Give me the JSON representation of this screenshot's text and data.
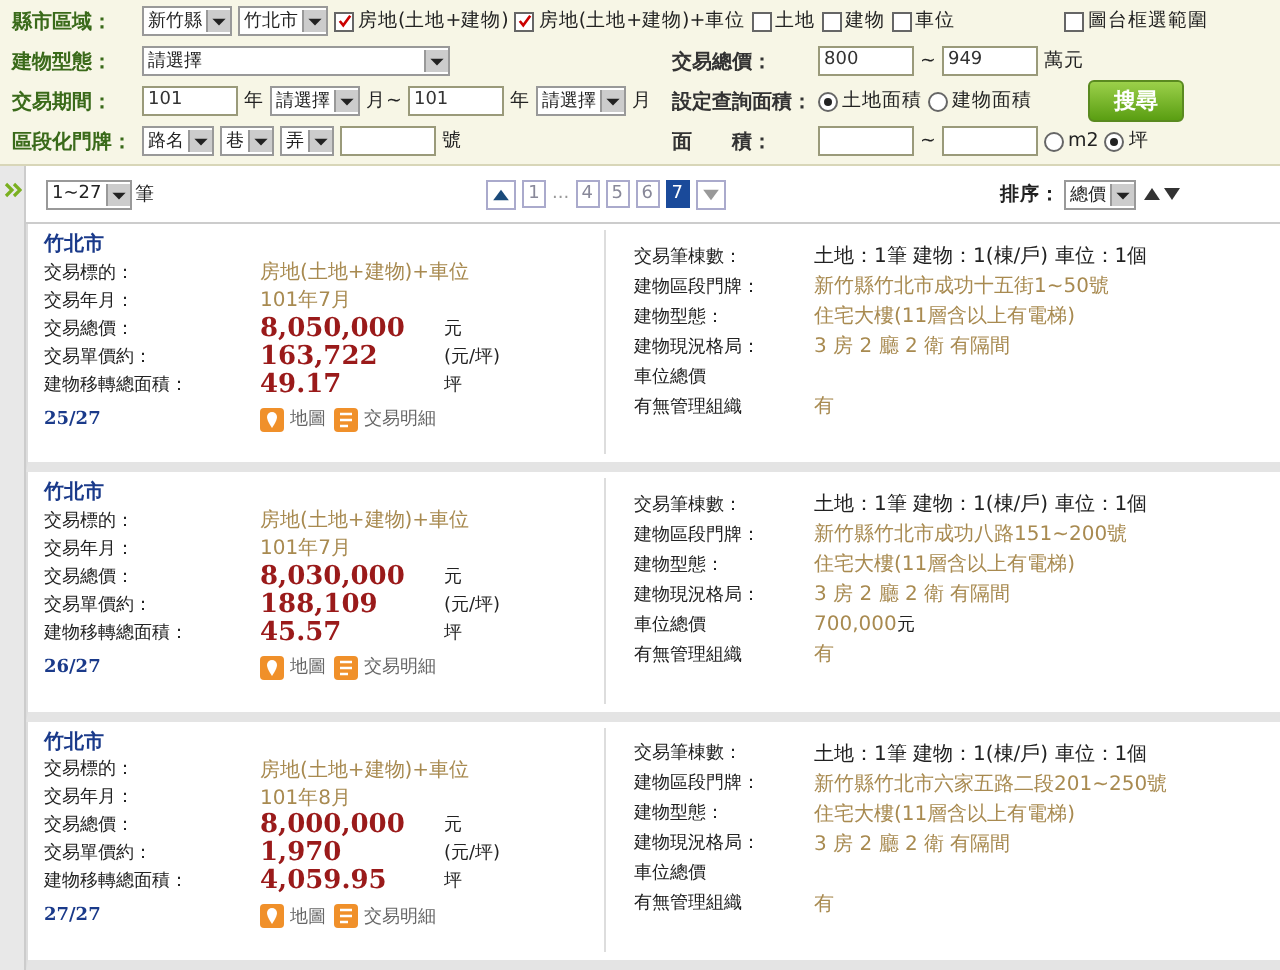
{
  "form": {
    "rows": [
      {
        "left": {
          "label": "縣市區域：",
          "parts": [
            {
              "kind": "select",
              "value": "新竹縣"
            },
            {
              "kind": "select",
              "value": "竹北市"
            },
            {
              "kind": "checkbox",
              "label": "房地(土地+建物)",
              "checked": true
            },
            {
              "kind": "checkbox",
              "label": "房地(土地+建物)+車位",
              "checked": true
            },
            {
              "kind": "checkbox",
              "label": "土地",
              "checked": false
            },
            {
              "kind": "checkbox",
              "label": "建物",
              "checked": false
            },
            {
              "kind": "checkbox",
              "label": "車位",
              "checked": false
            }
          ]
        },
        "right": {
          "parts": [
            {
              "kind": "checkbox",
              "label": "圖台框選範圍",
              "checked": false
            }
          ]
        }
      },
      {
        "left": {
          "label": "建物型態：",
          "parts": [
            {
              "kind": "long_select",
              "value": "請選擇"
            }
          ]
        },
        "right": {
          "label": "交易總價：",
          "parts": [
            {
              "kind": "input",
              "value": "800"
            },
            {
              "kind": "text",
              "text": "~"
            },
            {
              "kind": "input",
              "value": "949"
            },
            {
              "kind": "text",
              "text": "萬元"
            }
          ]
        }
      },
      {
        "left": {
          "label": "交易期間：",
          "parts": [
            {
              "kind": "input",
              "value": "101"
            },
            {
              "kind": "text",
              "text": "年"
            },
            {
              "kind": "select",
              "value": "請選擇"
            },
            {
              "kind": "text",
              "text": "月~"
            },
            {
              "kind": "input",
              "value": "101"
            },
            {
              "kind": "text",
              "text": "年"
            },
            {
              "kind": "select",
              "value": "請選擇"
            },
            {
              "kind": "text",
              "text": "月"
            }
          ]
        },
        "right": {
          "label": "設定查詢面積：",
          "parts": [
            {
              "kind": "radio",
              "label": "土地面積",
              "selected": true
            },
            {
              "kind": "radio",
              "label": "建物面積",
              "selected": false
            }
          ]
        }
      },
      {
        "left": {
          "label": "區段化門牌：",
          "parts": [
            {
              "kind": "select",
              "value": "路名"
            },
            {
              "kind": "select",
              "value": "巷"
            },
            {
              "kind": "select",
              "value": "弄"
            },
            {
              "kind": "input"
            },
            {
              "kind": "text",
              "text": "號"
            }
          ]
        },
        "right": {
          "label": "面　　積：",
          "parts": [
            {
              "kind": "input"
            },
            {
              "kind": "text",
              "text": "~"
            },
            {
              "kind": "input"
            },
            {
              "kind": "radio",
              "label": "m2",
              "selected": false
            },
            {
              "kind": "radio",
              "label": "坪",
              "selected": true
            }
          ]
        }
      }
    ],
    "search_button": "搜尋"
  },
  "pagination": {
    "per_page": "1~27",
    "per_page_unit": "筆",
    "pages": [
      {
        "kind": "prev"
      },
      {
        "kind": "page",
        "label": "1",
        "selected": false
      },
      {
        "kind": "ellipsis",
        "label": "..."
      },
      {
        "kind": "page",
        "label": "4",
        "selected": false
      },
      {
        "kind": "page",
        "label": "5",
        "selected": false
      },
      {
        "kind": "page",
        "label": "6",
        "selected": false
      },
      {
        "kind": "page",
        "label": "7",
        "selected": true
      },
      {
        "kind": "next"
      }
    ],
    "sort_label": "排序：",
    "sort_value": "總價"
  },
  "records": [
    {
      "city": "竹北市",
      "index": "25/27",
      "left": [
        {
          "label": "交易標的：",
          "kind": "text",
          "value": "房地(土地+建物)+車位"
        },
        {
          "label": "交易年月：",
          "kind": "text",
          "value": "101年7月"
        },
        {
          "label": "交易總價：",
          "kind": "price",
          "value": "8,050,000",
          "unit": "元"
        },
        {
          "label": "交易單價約：",
          "kind": "price",
          "value": "163,722",
          "unit": "(元/坪)"
        },
        {
          "label": "建物移轉總面積：",
          "kind": "price",
          "value": "49.17",
          "unit": "坪"
        }
      ],
      "links": [
        {
          "kind": "map",
          "label": "地圖"
        },
        {
          "kind": "detail",
          "label": "交易明細"
        }
      ],
      "right": [
        {
          "label": "交易筆棟數：",
          "kind": "plain",
          "value": "土地：1筆 建物：1(棟/戶) 車位：1個"
        },
        {
          "label": "建物區段門牌：",
          "kind": "text",
          "value": "新竹縣竹北市成功十五街1~50號"
        },
        {
          "label": "建物型態：",
          "kind": "text",
          "value": "住宅大樓(11層含以上有電梯)"
        },
        {
          "label": "建物現況格局：",
          "kind": "text",
          "value": "3 房 2 廳 2 衛 有隔間"
        },
        {
          "label": "車位總價"
        },
        {
          "label": "有無管理組織",
          "kind": "text",
          "value": "有"
        }
      ]
    },
    {
      "city": "竹北市",
      "index": "26/27",
      "left": [
        {
          "label": "交易標的：",
          "kind": "text",
          "value": "房地(土地+建物)+車位"
        },
        {
          "label": "交易年月：",
          "kind": "text",
          "value": "101年7月"
        },
        {
          "label": "交易總價：",
          "kind": "price",
          "value": "8,030,000",
          "unit": "元"
        },
        {
          "label": "交易單價約：",
          "kind": "price",
          "value": "188,109",
          "unit": "(元/坪)"
        },
        {
          "label": "建物移轉總面積：",
          "kind": "price",
          "value": "45.57",
          "unit": "坪"
        }
      ],
      "links": [
        {
          "kind": "map",
          "label": "地圖"
        },
        {
          "kind": "detail",
          "label": "交易明細"
        }
      ],
      "right": [
        {
          "label": "交易筆棟數：",
          "kind": "plain",
          "value": "土地：1筆 建物：1(棟/戶) 車位：1個"
        },
        {
          "label": "建物區段門牌：",
          "kind": "text",
          "value": "新竹縣竹北市成功八路151~200號"
        },
        {
          "label": "建物型態：",
          "kind": "text",
          "value": "住宅大樓(11層含以上有電梯)"
        },
        {
          "label": "建物現況格局：",
          "kind": "text",
          "value": "3 房 2 廳 2 衛 有隔間"
        },
        {
          "label": "車位總價",
          "kind": "text",
          "value": "700,000",
          "unit": "元"
        },
        {
          "label": "有無管理組織",
          "kind": "text",
          "value": "有"
        }
      ]
    },
    {
      "city": "竹北市",
      "index": "27/27",
      "left": [
        {
          "label": "交易標的：",
          "kind": "text",
          "value": "房地(土地+建物)+車位"
        },
        {
          "label": "交易年月：",
          "kind": "text",
          "value": "101年8月"
        },
        {
          "label": "交易總價：",
          "kind": "price",
          "value": "8,000,000",
          "unit": "元"
        },
        {
          "label": "交易單價約：",
          "kind": "price",
          "value": "1,970",
          "unit": "(元/坪)"
        },
        {
          "label": "建物移轉總面積：",
          "kind": "price",
          "value": "4,059.95",
          "unit": "坪"
        }
      ],
      "links": [
        {
          "kind": "map",
          "label": "地圖"
        },
        {
          "kind": "detail",
          "label": "交易明細"
        }
      ],
      "right": [
        {
          "label": "交易筆棟數：",
          "kind": "plain",
          "value": "土地：1筆 建物：1(棟/戶) 車位：1個"
        },
        {
          "label": "建物區段門牌：",
          "kind": "text",
          "value": "新竹縣竹北市六家五路二段201~250號"
        },
        {
          "label": "建物型態：",
          "kind": "text",
          "value": "住宅大樓(11層含以上有電梯)"
        },
        {
          "label": "建物現況格局：",
          "kind": "text",
          "value": "3 房 2 廳 2 衛 有隔間"
        },
        {
          "label": "車位總價"
        },
        {
          "label": "有無管理組織",
          "kind": "text",
          "value": "有"
        }
      ]
    }
  ]
}
